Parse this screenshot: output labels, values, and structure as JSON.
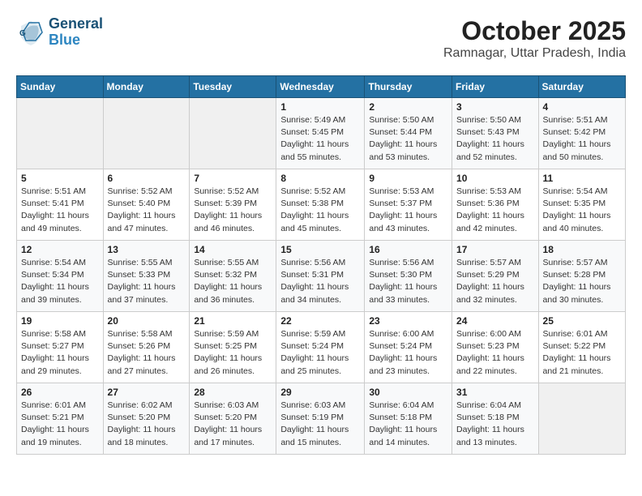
{
  "logo": {
    "line1": "General",
    "line2": "Blue"
  },
  "header": {
    "title": "October 2025",
    "subtitle": "Ramnagar, Uttar Pradesh, India"
  },
  "weekdays": [
    "Sunday",
    "Monday",
    "Tuesday",
    "Wednesday",
    "Thursday",
    "Friday",
    "Saturday"
  ],
  "weeks": [
    [
      {
        "day": "",
        "detail": ""
      },
      {
        "day": "",
        "detail": ""
      },
      {
        "day": "",
        "detail": ""
      },
      {
        "day": "1",
        "detail": "Sunrise: 5:49 AM\nSunset: 5:45 PM\nDaylight: 11 hours\nand 55 minutes."
      },
      {
        "day": "2",
        "detail": "Sunrise: 5:50 AM\nSunset: 5:44 PM\nDaylight: 11 hours\nand 53 minutes."
      },
      {
        "day": "3",
        "detail": "Sunrise: 5:50 AM\nSunset: 5:43 PM\nDaylight: 11 hours\nand 52 minutes."
      },
      {
        "day": "4",
        "detail": "Sunrise: 5:51 AM\nSunset: 5:42 PM\nDaylight: 11 hours\nand 50 minutes."
      }
    ],
    [
      {
        "day": "5",
        "detail": "Sunrise: 5:51 AM\nSunset: 5:41 PM\nDaylight: 11 hours\nand 49 minutes."
      },
      {
        "day": "6",
        "detail": "Sunrise: 5:52 AM\nSunset: 5:40 PM\nDaylight: 11 hours\nand 47 minutes."
      },
      {
        "day": "7",
        "detail": "Sunrise: 5:52 AM\nSunset: 5:39 PM\nDaylight: 11 hours\nand 46 minutes."
      },
      {
        "day": "8",
        "detail": "Sunrise: 5:52 AM\nSunset: 5:38 PM\nDaylight: 11 hours\nand 45 minutes."
      },
      {
        "day": "9",
        "detail": "Sunrise: 5:53 AM\nSunset: 5:37 PM\nDaylight: 11 hours\nand 43 minutes."
      },
      {
        "day": "10",
        "detail": "Sunrise: 5:53 AM\nSunset: 5:36 PM\nDaylight: 11 hours\nand 42 minutes."
      },
      {
        "day": "11",
        "detail": "Sunrise: 5:54 AM\nSunset: 5:35 PM\nDaylight: 11 hours\nand 40 minutes."
      }
    ],
    [
      {
        "day": "12",
        "detail": "Sunrise: 5:54 AM\nSunset: 5:34 PM\nDaylight: 11 hours\nand 39 minutes."
      },
      {
        "day": "13",
        "detail": "Sunrise: 5:55 AM\nSunset: 5:33 PM\nDaylight: 11 hours\nand 37 minutes."
      },
      {
        "day": "14",
        "detail": "Sunrise: 5:55 AM\nSunset: 5:32 PM\nDaylight: 11 hours\nand 36 minutes."
      },
      {
        "day": "15",
        "detail": "Sunrise: 5:56 AM\nSunset: 5:31 PM\nDaylight: 11 hours\nand 34 minutes."
      },
      {
        "day": "16",
        "detail": "Sunrise: 5:56 AM\nSunset: 5:30 PM\nDaylight: 11 hours\nand 33 minutes."
      },
      {
        "day": "17",
        "detail": "Sunrise: 5:57 AM\nSunset: 5:29 PM\nDaylight: 11 hours\nand 32 minutes."
      },
      {
        "day": "18",
        "detail": "Sunrise: 5:57 AM\nSunset: 5:28 PM\nDaylight: 11 hours\nand 30 minutes."
      }
    ],
    [
      {
        "day": "19",
        "detail": "Sunrise: 5:58 AM\nSunset: 5:27 PM\nDaylight: 11 hours\nand 29 minutes."
      },
      {
        "day": "20",
        "detail": "Sunrise: 5:58 AM\nSunset: 5:26 PM\nDaylight: 11 hours\nand 27 minutes."
      },
      {
        "day": "21",
        "detail": "Sunrise: 5:59 AM\nSunset: 5:25 PM\nDaylight: 11 hours\nand 26 minutes."
      },
      {
        "day": "22",
        "detail": "Sunrise: 5:59 AM\nSunset: 5:24 PM\nDaylight: 11 hours\nand 25 minutes."
      },
      {
        "day": "23",
        "detail": "Sunrise: 6:00 AM\nSunset: 5:24 PM\nDaylight: 11 hours\nand 23 minutes."
      },
      {
        "day": "24",
        "detail": "Sunrise: 6:00 AM\nSunset: 5:23 PM\nDaylight: 11 hours\nand 22 minutes."
      },
      {
        "day": "25",
        "detail": "Sunrise: 6:01 AM\nSunset: 5:22 PM\nDaylight: 11 hours\nand 21 minutes."
      }
    ],
    [
      {
        "day": "26",
        "detail": "Sunrise: 6:01 AM\nSunset: 5:21 PM\nDaylight: 11 hours\nand 19 minutes."
      },
      {
        "day": "27",
        "detail": "Sunrise: 6:02 AM\nSunset: 5:20 PM\nDaylight: 11 hours\nand 18 minutes."
      },
      {
        "day": "28",
        "detail": "Sunrise: 6:03 AM\nSunset: 5:20 PM\nDaylight: 11 hours\nand 17 minutes."
      },
      {
        "day": "29",
        "detail": "Sunrise: 6:03 AM\nSunset: 5:19 PM\nDaylight: 11 hours\nand 15 minutes."
      },
      {
        "day": "30",
        "detail": "Sunrise: 6:04 AM\nSunset: 5:18 PM\nDaylight: 11 hours\nand 14 minutes."
      },
      {
        "day": "31",
        "detail": "Sunrise: 6:04 AM\nSunset: 5:18 PM\nDaylight: 11 hours\nand 13 minutes."
      },
      {
        "day": "",
        "detail": ""
      }
    ]
  ]
}
